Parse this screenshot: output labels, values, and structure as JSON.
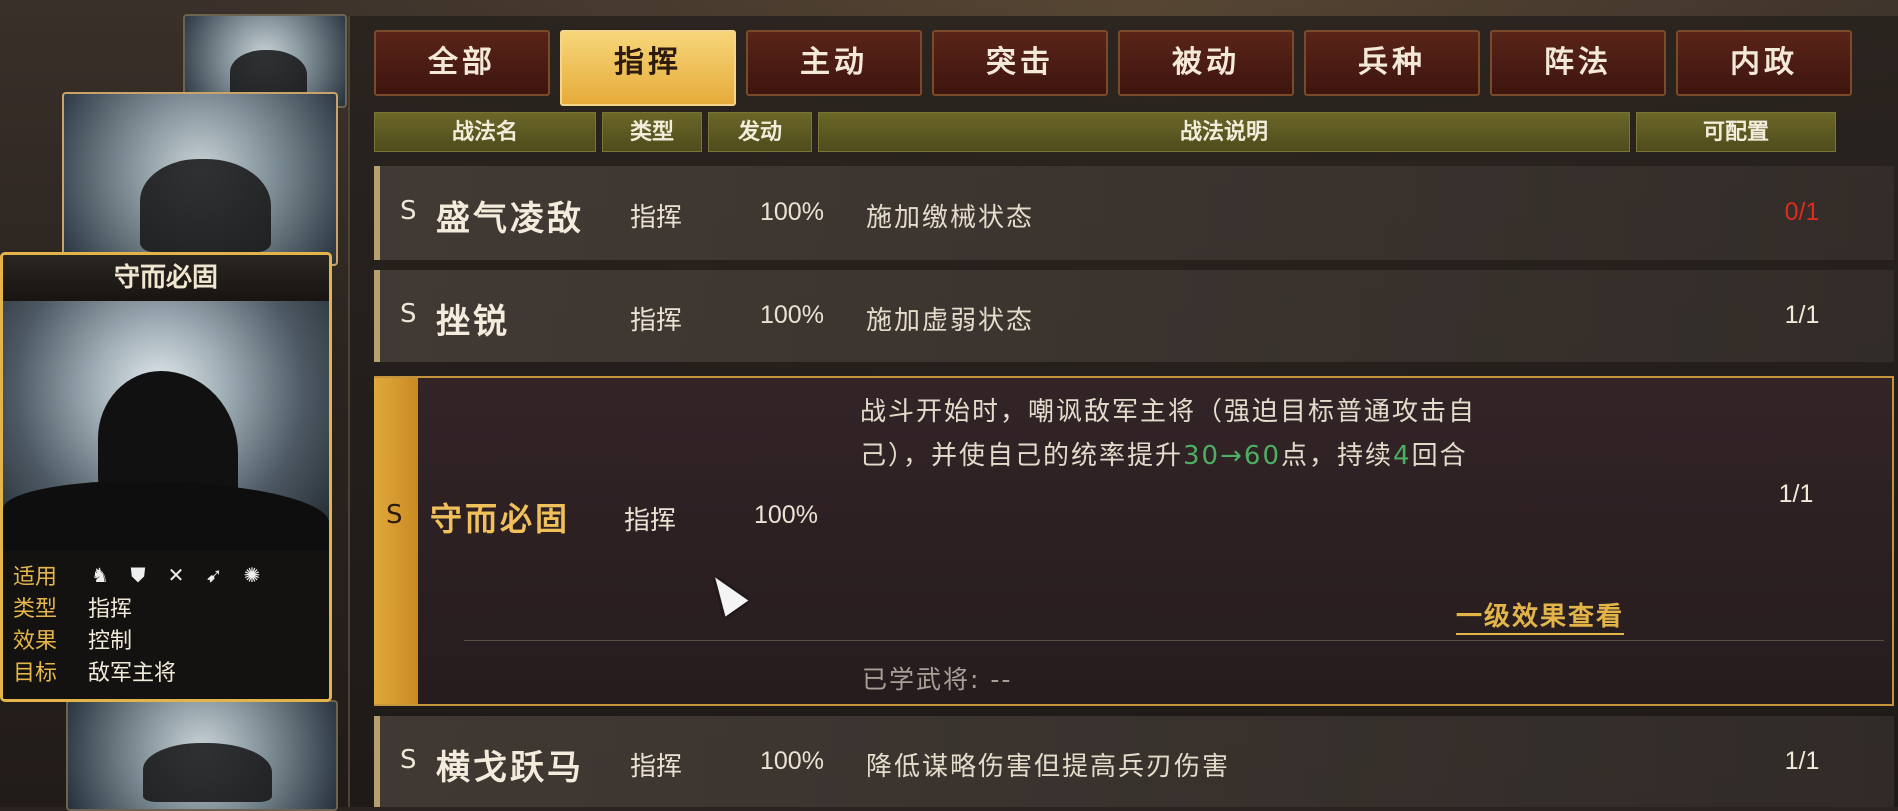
{
  "tabs": [
    "全部",
    "指挥",
    "主动",
    "突击",
    "被动",
    "兵种",
    "阵法",
    "内政"
  ],
  "active_tab_index": 1,
  "columns": {
    "name": "战法名",
    "type": "类型",
    "rate": "发动",
    "desc": "战法说明",
    "config": "可配置"
  },
  "skills": [
    {
      "grade": "S",
      "name": "盛气凌敌",
      "type": "指挥",
      "rate": "100%",
      "desc": "施加缴械状态",
      "count": "0/1"
    },
    {
      "grade": "S",
      "name": "挫锐",
      "type": "指挥",
      "rate": "100%",
      "desc": "施加虚弱状态",
      "count": "1/1"
    },
    {
      "grade": "S",
      "name": "守而必固",
      "type": "指挥",
      "rate": "100%",
      "count": "1/1",
      "desc_line1": "战斗开始时，嘲讽敌军主将（强迫目标普通攻击自",
      "desc_line2_a": "己），并使自己的统率提升",
      "desc_val1": "30",
      "desc_arrow": "→",
      "desc_val2": "60",
      "desc_line2_b": "点，持续",
      "desc_val3": "4",
      "desc_line2_c": "回合",
      "level_link": "一级效果查看",
      "learned": "已学武将: --"
    },
    {
      "grade": "S",
      "name": "横戈跃马",
      "type": "指挥",
      "rate": "100%",
      "desc": "降低谋略伤害但提高兵刃伤害",
      "count": "1/1"
    }
  ],
  "card": {
    "title": "守而必固",
    "apply_label": "适用",
    "troop_icons": [
      "cavalry-icon",
      "shield-icon",
      "archer-icon",
      "spear-icon",
      "wheel-icon"
    ],
    "type_label": "类型",
    "type_value": "指挥",
    "effect_label": "效果",
    "effect_value": "控制",
    "target_label": "目标",
    "target_value": "敌军主将"
  },
  "colors": {
    "accent": "#e6ab3a",
    "limit_red": "#e02a1e",
    "value_green": "#4caf62",
    "tab_red": "#5a2418"
  }
}
